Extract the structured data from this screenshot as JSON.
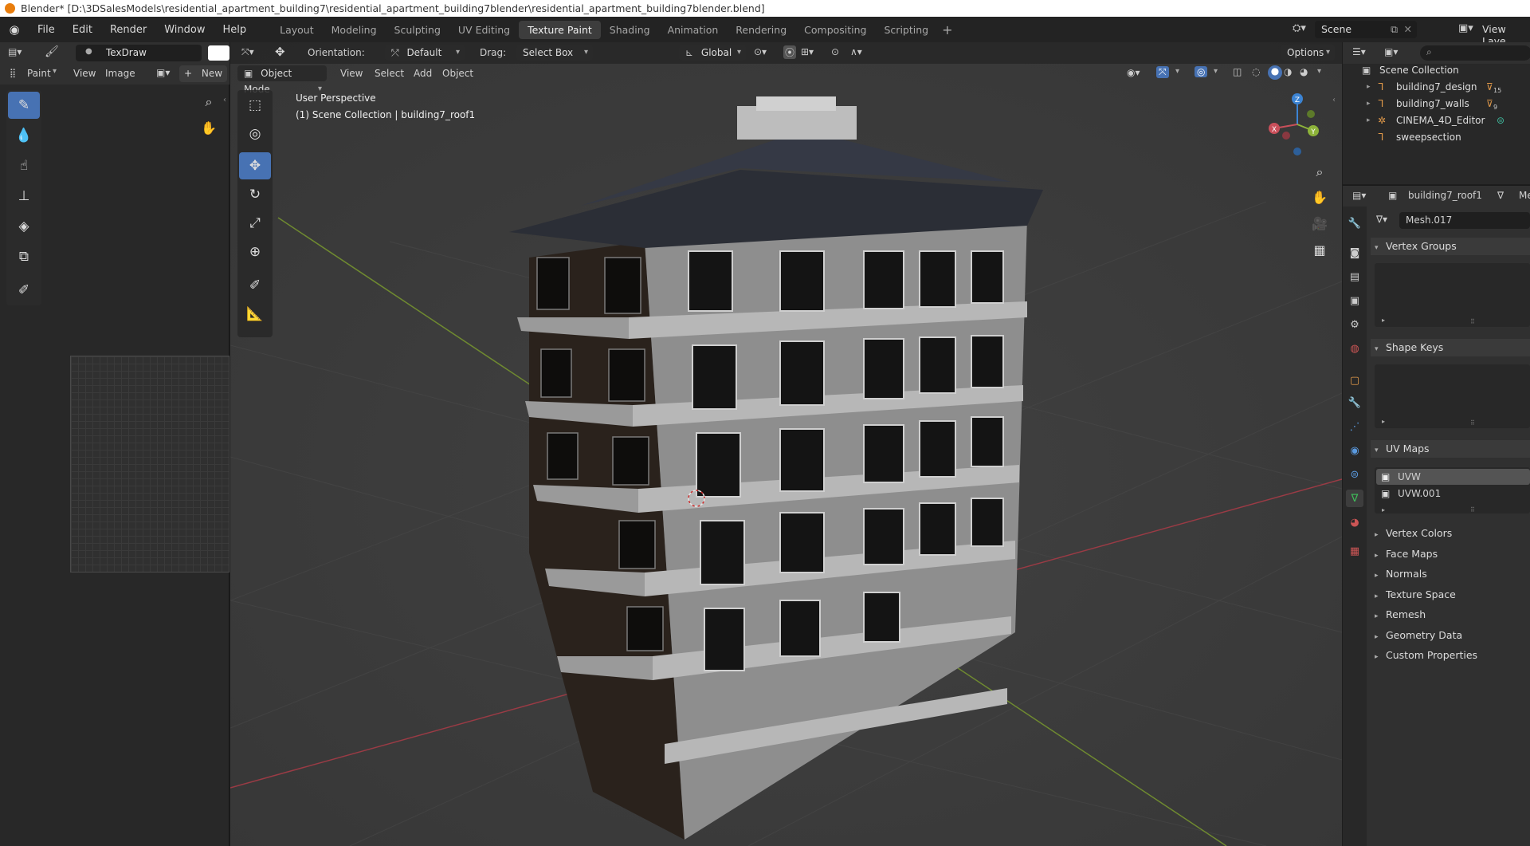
{
  "window": {
    "title": "Blender* [D:\\3DSalesModels\\residential_apartment_building7\\residential_apartment_building7blender\\residential_apartment_building7blender.blend]"
  },
  "menu": [
    "File",
    "Edit",
    "Render",
    "Window",
    "Help"
  ],
  "workspaces": [
    "Layout",
    "Modeling",
    "Sculpting",
    "UV Editing",
    "Texture Paint",
    "Shading",
    "Animation",
    "Rendering",
    "Compositing",
    "Scripting"
  ],
  "active_workspace": "Texture Paint",
  "scene": {
    "name": "Scene",
    "view_layer": "View Laye"
  },
  "image_editor": {
    "brush_name": "TexDraw",
    "mode": "Paint",
    "view": "View",
    "image": "Image",
    "new": "New"
  },
  "viewport": {
    "orientation_label": "Orientation:",
    "orientation_value": "Default",
    "drag_label": "Drag:",
    "drag_value": "Select Box",
    "transform": "Global",
    "options": "Options",
    "mode": "Object Mode",
    "menus": [
      "View",
      "Select",
      "Add",
      "Object"
    ],
    "overlay_title": "User Perspective",
    "overlay_sub": "(1) Scene Collection | building7_roof1",
    "gizmo": {
      "x": "X",
      "y": "Y",
      "z": "Z"
    }
  },
  "outliner": {
    "root": "Scene Collection",
    "items": [
      {
        "name": "building7_design",
        "badge": "15"
      },
      {
        "name": "building7_walls",
        "badge": "9"
      },
      {
        "name": "CINEMA_4D_Editor",
        "badge": ""
      },
      {
        "name": "sweepsection",
        "badge": ""
      }
    ]
  },
  "properties": {
    "object": "building7_roof1",
    "data_tab": "Me",
    "mesh": "Mesh.017",
    "sections_open": [
      "Vertex Groups",
      "Shape Keys",
      "UV Maps"
    ],
    "uv_maps": [
      "UVW",
      "UVW.001"
    ],
    "sections_closed": [
      "Vertex Colors",
      "Face Maps",
      "Normals",
      "Texture Space",
      "Remesh",
      "Geometry Data",
      "Custom Properties"
    ]
  },
  "colors": {
    "accent": "#4772b3",
    "bg": "#3d3d3d",
    "panel": "#303030",
    "x_axis": "#c94f5a",
    "y_axis": "#8db33a",
    "z_axis": "#3c84d4"
  }
}
